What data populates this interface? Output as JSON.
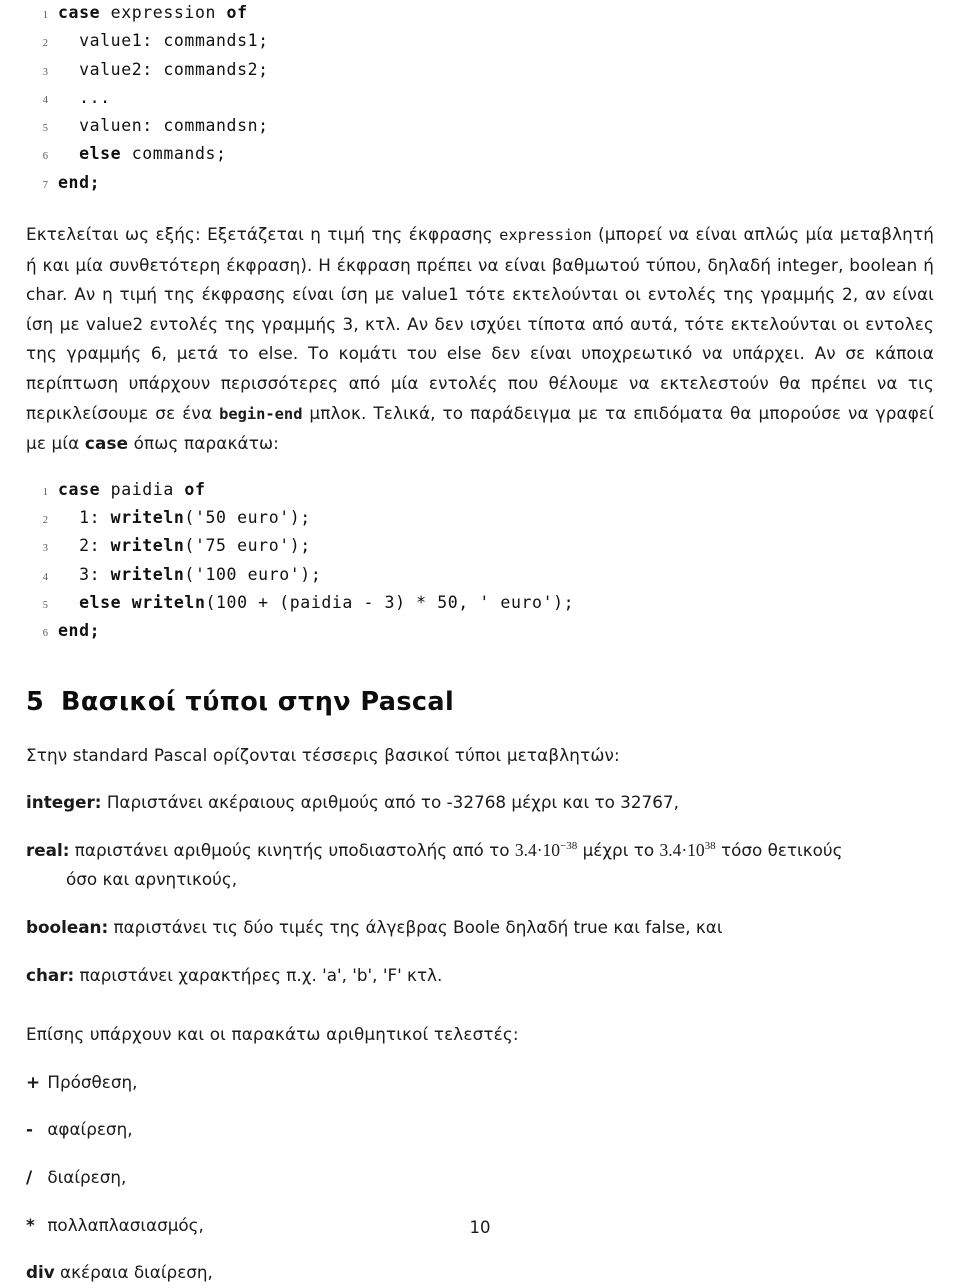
{
  "document": {
    "page_number": "10",
    "language": "el"
  },
  "listing1": {
    "lines": [
      {
        "no": "1",
        "segments": [
          {
            "t": "case",
            "bold": true
          },
          {
            "t": " expression ",
            "bold": false
          },
          {
            "t": "of",
            "bold": true
          }
        ]
      },
      {
        "no": "2",
        "segments": [
          {
            "t": "  value1: commands1;",
            "bold": false
          }
        ]
      },
      {
        "no": "3",
        "segments": [
          {
            "t": "  value2: commands2;",
            "bold": false
          }
        ]
      },
      {
        "no": "4",
        "segments": [
          {
            "t": "  ...",
            "bold": false
          }
        ]
      },
      {
        "no": "5",
        "segments": [
          {
            "t": "  valuen: commandsn;",
            "bold": false
          }
        ]
      },
      {
        "no": "6",
        "segments": [
          {
            "t": "  else",
            "bold": true
          },
          {
            "t": " commands;",
            "bold": false
          }
        ]
      },
      {
        "no": "7",
        "segments": [
          {
            "t": "end;",
            "bold": true
          }
        ]
      }
    ]
  },
  "paragraph1": {
    "segments": [
      {
        "t": "Εκτελείται ως εξής: Εξετάζεται η τιμή της έκφρασης ",
        "style": "normal"
      },
      {
        "t": "expression",
        "style": "mono"
      },
      {
        "t": " (μπορεί να είναι απλώς μία μεταβλητή ή και μία συνθετότερη έκφραση). Η έκφραση πρέπει να είναι βαθμωτού τύπου, δηλαδή integer, boolean ή char. Αν η τιμή της έκφρασης είναι ίση με value1 τότε εκτελούνται οι εντολές της γραμμής 2, αν είναι ίση με value2 εντολές της γραμμής 3, κτλ. Αν δεν ισχύει τίποτα από αυτά, τότε εκτελούνται οι εντολες της γραμμής 6, μετά το else. Το κομάτι του else δεν είναι υποχρεωτικό να υπάρχει. Αν σε κάποια περίπτωση υπάρχουν περισσότερες από μία εντολές που θέλουμε να εκτελεστούν θα πρέπει να τις περικλείσουμε σε ένα ",
        "style": "normal"
      },
      {
        "t": "begin-end",
        "style": "mono-bold"
      },
      {
        "t": " μπλοκ. Τελικά, το παράδειγμα με τα επιδόματα θα μπορούσε να γραφεί με μία ",
        "style": "normal"
      },
      {
        "t": "case",
        "style": "bold"
      },
      {
        "t": " όπως παρακάτω:",
        "style": "normal"
      }
    ]
  },
  "listing2": {
    "lines": [
      {
        "no": "1",
        "segments": [
          {
            "t": "case",
            "bold": true
          },
          {
            "t": " paidia ",
            "bold": false
          },
          {
            "t": "of",
            "bold": true
          }
        ]
      },
      {
        "no": "2",
        "segments": [
          {
            "t": "  1: ",
            "bold": false
          },
          {
            "t": "writeln",
            "bold": true
          },
          {
            "t": "('50 euro');",
            "bold": false
          }
        ]
      },
      {
        "no": "3",
        "segments": [
          {
            "t": "  2: ",
            "bold": false
          },
          {
            "t": "writeln",
            "bold": true
          },
          {
            "t": "('75 euro');",
            "bold": false
          }
        ]
      },
      {
        "no": "4",
        "segments": [
          {
            "t": "  3: ",
            "bold": false
          },
          {
            "t": "writeln",
            "bold": true
          },
          {
            "t": "('100 euro');",
            "bold": false
          }
        ]
      },
      {
        "no": "5",
        "segments": [
          {
            "t": "  ",
            "bold": false
          },
          {
            "t": "else writeln",
            "bold": true
          },
          {
            "t": "(100 + (paidia - 3) * 50, ' euro');",
            "bold": false
          }
        ]
      },
      {
        "no": "6",
        "segments": [
          {
            "t": "end;",
            "bold": true
          }
        ]
      }
    ]
  },
  "section": {
    "number": "5",
    "title": "Βασικοί τύποι στην Pascal"
  },
  "paragraph2": {
    "text": "Στην standard Pascal ορίζονται τέσσερις βασικοί τύποι μεταβλητών:"
  },
  "types": {
    "integer": {
      "term": "integer:",
      "text": " Παριστάνει ακέραιους αριθμούς από το -32768 μέχρι και το 32767,"
    },
    "real": {
      "term": "real:",
      "text_before": " παριστάνει αριθμούς κινητής υποδιαστολής από το ",
      "math_low_base": "3.4·10",
      "math_low_exp": "−38",
      "text_middle": " μέχρι το ",
      "math_high_base": "3.4·10",
      "math_high_exp": "38",
      "text_after": " τόσο θετικούς",
      "text_cont": "όσο και αρνητικούς,"
    },
    "boolean": {
      "term": "boolean:",
      "text": " παριστάνει τις δύο τιμές της άλγεβρας Boole δηλαδή true και false, και"
    },
    "char": {
      "term": "char:",
      "text": " παριστάνει χαρακτήρες π.χ. 'a', 'b', 'F' κτλ."
    }
  },
  "paragraph3": {
    "text": "Επίσης υπάρχουν και οι παρακάτω αριθμητικοί τελεστές:"
  },
  "operators": [
    {
      "symbol": "+",
      "label": "Πρόσθεση,"
    },
    {
      "symbol": "-",
      "label": "αφαίρεση,"
    },
    {
      "symbol": "/",
      "label": "διαίρεση,"
    },
    {
      "symbol": "*",
      "label": "πολλαπλασιασμός,"
    },
    {
      "symbol": "div",
      "label": "ακέραια διαίρεση,"
    }
  ]
}
